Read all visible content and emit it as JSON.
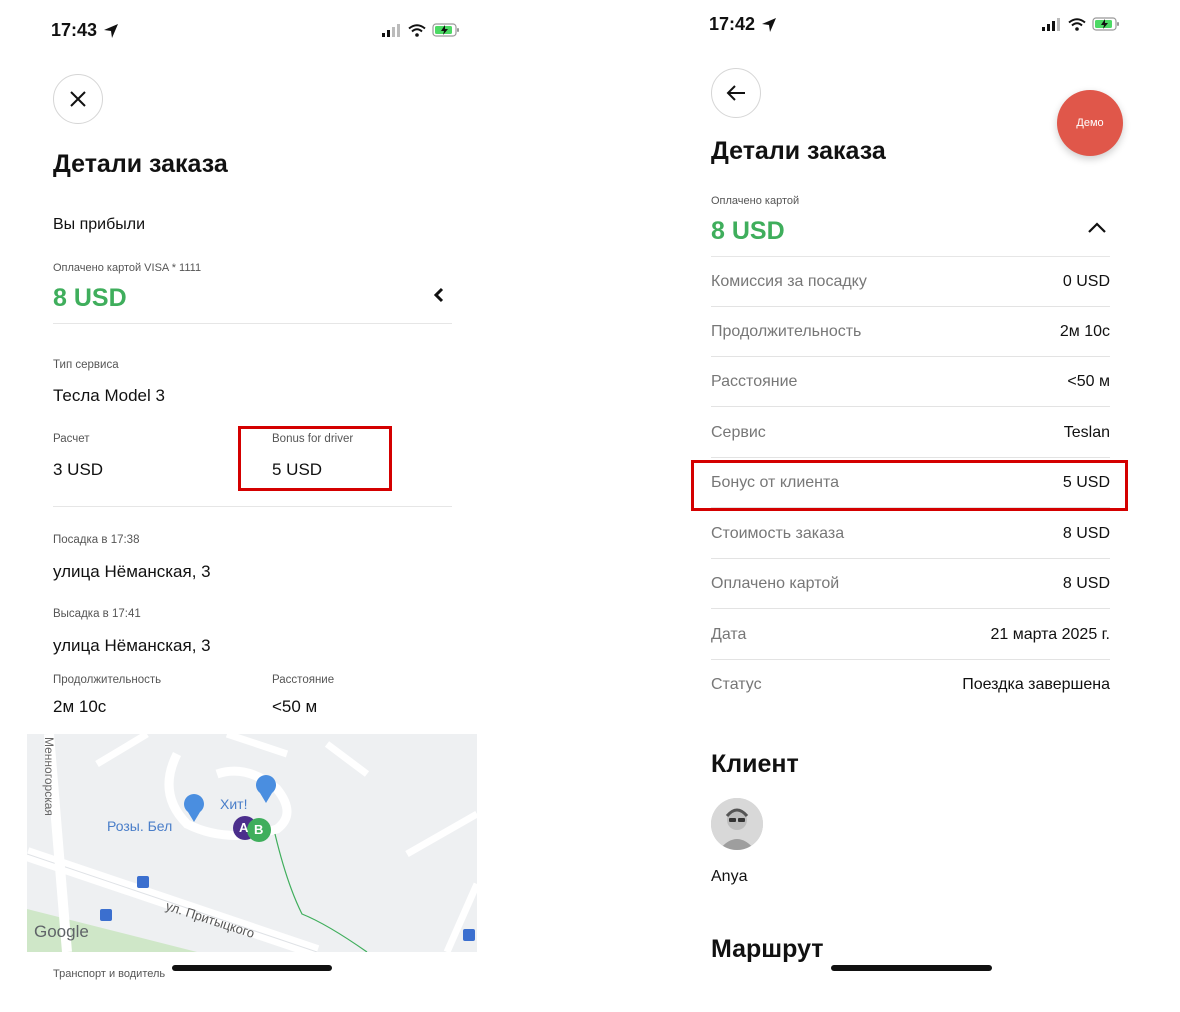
{
  "left": {
    "status_time": "17:43",
    "title": "Детали заказа",
    "arrived": "Вы прибыли",
    "paid_label": "Оплачено картой VISA * 1111",
    "price": "8 USD",
    "service_label": "Тип сервиса",
    "service_value": "Тесла Model 3",
    "calc_label": "Расчет",
    "calc_value": "3 USD",
    "bonus_label": "Bonus for driver",
    "bonus_value": "5 USD",
    "pickup_label": "Посадка в 17:38",
    "pickup_value": "улица Нёманская, 3",
    "dropoff_label": "Высадка в 17:41",
    "dropoff_value": "улица Нёманская, 3",
    "duration_label": "Продолжительность",
    "duration_value": "2м 10с",
    "distance_label": "Расстояние",
    "distance_value": "<50 м",
    "map": {
      "street_vertical": "Менногорская",
      "poi_1": "Хит!",
      "poi_2": "Розы. Бел",
      "street_2": "ул. Притыцкого",
      "marker_a": "A",
      "marker_b": "B",
      "google": "Google"
    },
    "next_section": "Транспорт и водитель"
  },
  "right": {
    "status_time": "17:42",
    "demo": "Демо",
    "title": "Детали заказа",
    "paid_label": "Оплачено картой",
    "price": "8 USD",
    "rows": [
      {
        "label": "Комиссия за посадку",
        "value": "0 USD"
      },
      {
        "label": "Продолжительность",
        "value": "2м 10с"
      },
      {
        "label": "Расстояние",
        "value": "<50 м"
      },
      {
        "label": "Сервис",
        "value": "Teslan"
      },
      {
        "label": "Бонус от клиента",
        "value": "5 USD"
      },
      {
        "label": "Стоимость заказа",
        "value": "8 USD"
      },
      {
        "label": "Оплачено картой",
        "value": "8 USD"
      },
      {
        "label": "Дата",
        "value": "21 марта 2025 г."
      },
      {
        "label": "Статус",
        "value": "Поездка завершена"
      }
    ],
    "client_title": "Клиент",
    "client_name": "Anya",
    "route_title": "Маршрут"
  },
  "icons": {
    "location_arrow": "location-arrow-icon",
    "signal": "signal-icon",
    "wifi": "wifi-icon",
    "battery": "battery-charging-icon",
    "close": "close-icon",
    "back": "back-arrow-icon",
    "chevron_left": "chevron-left-icon",
    "chevron_up": "chevron-up-icon"
  },
  "colors": {
    "price_green": "#3fae5c",
    "highlight_red": "#d40000",
    "demo_button": "#e0574a",
    "battery_green": "#4cd964"
  }
}
